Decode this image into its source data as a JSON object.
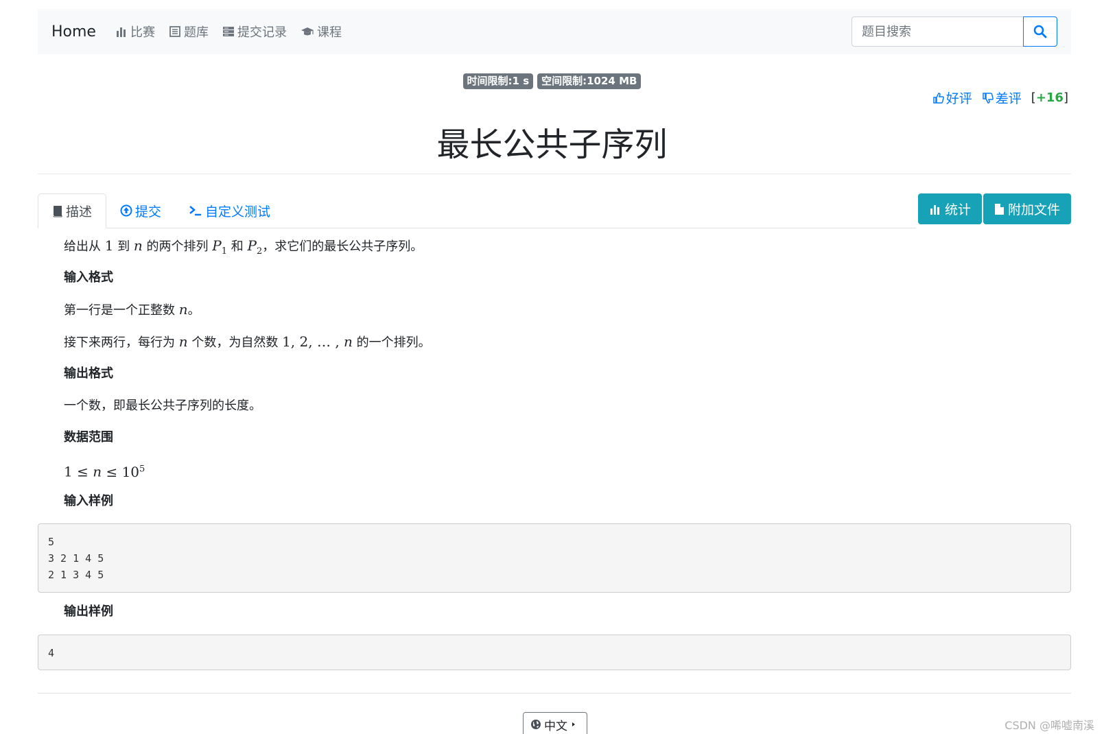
{
  "navbar": {
    "brand": "Home",
    "items": [
      {
        "label": "比赛",
        "icon": "bar-chart-icon"
      },
      {
        "label": "题库",
        "icon": "list-icon"
      },
      {
        "label": "提交记录",
        "icon": "server-icon"
      },
      {
        "label": "课程",
        "icon": "graduation-cap-icon"
      }
    ],
    "search": {
      "placeholder": "题目搜索",
      "value": ""
    }
  },
  "limits": {
    "time": "时间限制:1 s",
    "memory": "空间限制:1024 MB"
  },
  "votes": {
    "like_label": "好评",
    "dislike_label": "差评",
    "score_open": "[",
    "score": "+16",
    "score_close": "]"
  },
  "problem": {
    "title": "最长公共子序列"
  },
  "tabs": [
    {
      "label": "描述",
      "icon": "book-icon",
      "active": true
    },
    {
      "label": "提交",
      "icon": "upload-circle-icon",
      "active": false
    },
    {
      "label": "自定义测试",
      "icon": "terminal-icon",
      "active": false
    }
  ],
  "actions": {
    "stats_label": "统计",
    "attachment_label": "附加文件"
  },
  "description": {
    "intro": {
      "t1": "给出从 ",
      "m1": "1",
      "t2": " 到 ",
      "m2": "n",
      "t3": " 的两个排列 ",
      "m3": "P",
      "m3sub": "1",
      "t4": " 和 ",
      "m4": "P",
      "m4sub": "2",
      "t5": "，求它们的最长公共子序列。"
    },
    "input_heading": "输入格式",
    "input_line1": {
      "t1": "第一行是一个正整数 ",
      "m1": "n",
      "t2": "。"
    },
    "input_line2": {
      "t1": "接下来两行，每行为 ",
      "m1": "n",
      "t2": " 个数，为自然数 ",
      "m2": "1, 2, … , ",
      "m2i": "n",
      "t3": " 的一个排列。"
    },
    "output_heading": "输出格式",
    "output_line": "一个数，即最长公共子序列的长度。",
    "range_heading": "数据范围",
    "range": {
      "a": "1 ≤ ",
      "n": "n",
      "b": " ≤ 10",
      "sup": "5"
    },
    "sample_input_heading": "输入样例",
    "sample_input": [
      "5",
      "3 2 1 4 5",
      "2 1 3 4 5"
    ],
    "sample_output_heading": "输出样例",
    "sample_output": [
      "4"
    ]
  },
  "footer": {
    "language": "中文"
  },
  "watermark": "CSDN @唏嘘南溪",
  "colors": {
    "primary": "#007bff",
    "info": "#17a2b8",
    "success": "#28a745",
    "badge": "#6c757d"
  }
}
